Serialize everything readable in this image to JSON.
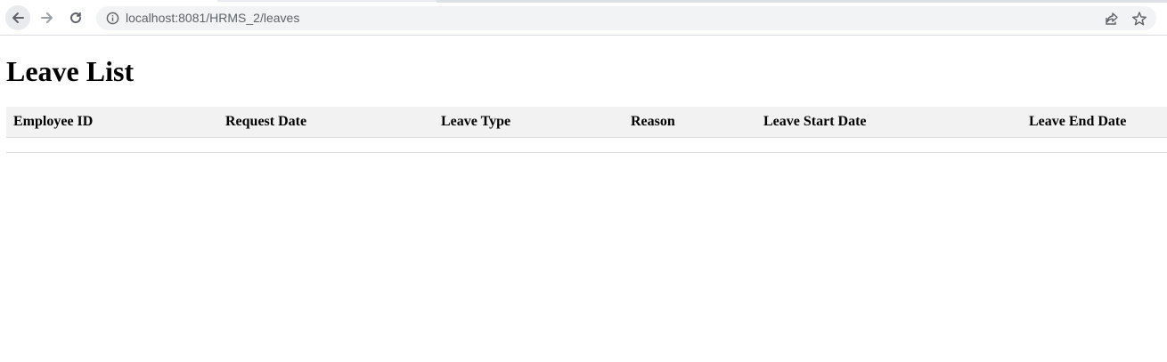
{
  "browser": {
    "url": "localhost:8081/HRMS_2/leaves",
    "icons": {
      "back": "arrow-back-icon",
      "forward": "arrow-forward-icon",
      "reload": "reload-icon",
      "site_info": "info-icon",
      "share": "share-icon",
      "bookmark": "star-icon"
    }
  },
  "page": {
    "title": "Leave List"
  },
  "table": {
    "columns": [
      "Employee ID",
      "Request Date",
      "Leave Type",
      "Reason",
      "Leave Start Date",
      "Leave End Date"
    ],
    "rows": []
  },
  "colors": {
    "header_bg": "#f2f2f2",
    "border": "#dddddd",
    "omnibox_bg": "#f1f3f4",
    "url_text": "#5f6368"
  }
}
